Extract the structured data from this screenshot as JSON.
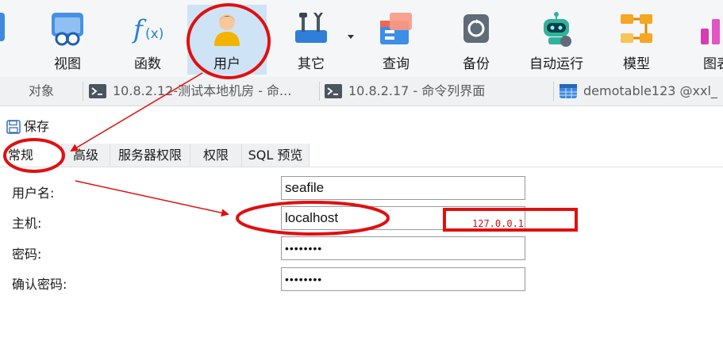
{
  "toolbar": {
    "items": [
      {
        "label": "视图",
        "icon": "view-icon"
      },
      {
        "label": "函数",
        "icon": "function-icon"
      },
      {
        "label": "用户",
        "icon": "user-icon"
      },
      {
        "label": "其它",
        "icon": "tools-icon"
      },
      {
        "label": "查询",
        "icon": "query-icon"
      },
      {
        "label": "备份",
        "icon": "backup-icon"
      },
      {
        "label": "自动运行",
        "icon": "robot-icon"
      },
      {
        "label": "模型",
        "icon": "model-icon"
      },
      {
        "label": "图表",
        "icon": "chart-icon"
      }
    ],
    "active": "用户"
  },
  "object_tabs": {
    "objects_label": "对象",
    "tabs": [
      {
        "label": "10.8.2.12-测试本地机房 - 命...",
        "icon": "terminal-icon"
      },
      {
        "label": "10.8.2.17 - 命令列界面",
        "icon": "terminal-icon"
      },
      {
        "label": "demotable123 @xxl_",
        "icon": "table-icon"
      }
    ]
  },
  "actions": {
    "save_label": "保存"
  },
  "property_tabs": [
    "常规",
    "高级",
    "服务器权限",
    "权限",
    "SQL 预览"
  ],
  "form": {
    "username_label": "用户名:",
    "username_value": "seafile",
    "host_label": "主机:",
    "host_value": "localhost",
    "password_label": "密码:",
    "password_value": "••••••••",
    "confirm_label": "确认密码:",
    "confirm_value": "••••••••"
  },
  "annotation": {
    "note": "127.0.0.1",
    "color": "#e01010"
  },
  "colors": {
    "active_tool_bg": "#cfe3f6",
    "toolbar_bg": "#f5f6f8",
    "annotation_red": "#e01010"
  }
}
